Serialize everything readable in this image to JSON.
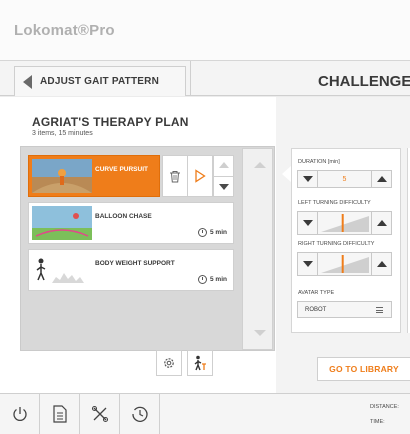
{
  "app": {
    "title": "Lokomat®Pro"
  },
  "nav": {
    "back_label": "ADJUST GAIT PATTERN",
    "section_title": "CHALLENGE P"
  },
  "plan": {
    "title": "AGRIAT'S THERAPY PLAN",
    "subtitle": "3 items, 15 minutes",
    "items": [
      {
        "name": "CURVE PURSUIT",
        "duration": "",
        "active": true
      },
      {
        "name": "BALLOON CHASE",
        "duration": "5 min",
        "active": false
      },
      {
        "name": "BODY WEIGHT SUPPORT",
        "duration": "5 min",
        "active": false
      }
    ]
  },
  "params": {
    "duration_label": "DURATION [min]",
    "duration_value": "5",
    "left_turning_label": "LEFT TURNING DIFFICULTY",
    "left_turning_level": 0.45,
    "right_turning_label": "RIGHT TURNING DIFFICULTY",
    "right_turning_level": 0.45,
    "avatar_label": "AVATAR TYPE",
    "avatar_value": "ROBOT"
  },
  "library": {
    "label": "GO TO LIBRARY"
  },
  "footer": {
    "distance_label": "DISTANCE:",
    "time_label": "TIME:"
  },
  "colors": {
    "accent": "#ef7d1a",
    "panel": "#d8d8d8",
    "background": "#ececec"
  },
  "icons": [
    "power-icon",
    "document-icon",
    "tools-icon",
    "history-icon",
    "gear-icon",
    "walker-icon",
    "trash-icon",
    "play-icon",
    "clock-icon",
    "menu-icon"
  ]
}
